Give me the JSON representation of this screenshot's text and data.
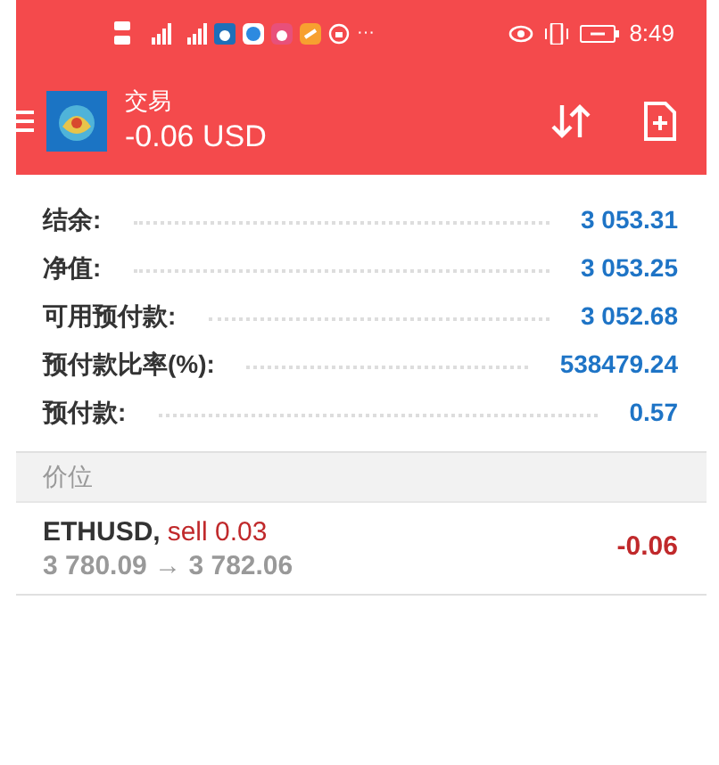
{
  "status_bar": {
    "time": "8:49",
    "overflow": "···"
  },
  "header": {
    "title": "交易",
    "subtitle": "-0.06 USD"
  },
  "account": [
    {
      "label": "结余:",
      "value": "3 053.31"
    },
    {
      "label": "净值:",
      "value": "3 053.25"
    },
    {
      "label": "可用预付款:",
      "value": "3 052.68"
    },
    {
      "label": "预付款比率(%):",
      "value": "538479.24"
    },
    {
      "label": "预付款:",
      "value": "0.57"
    }
  ],
  "section": {
    "title": "价位"
  },
  "positions": [
    {
      "symbol": "ETHUSD,",
      "side": "sell 0.03",
      "prices": "3 780.09 → 3 782.06",
      "profit": "-0.06"
    }
  ]
}
